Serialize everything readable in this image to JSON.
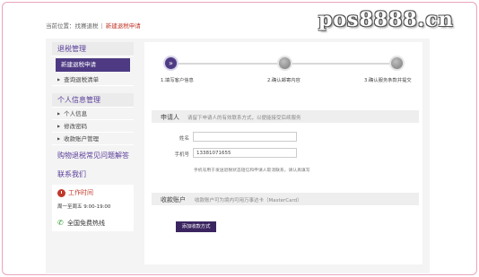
{
  "watermark": "pos8888.cn",
  "breadcrumb": {
    "prefix": "当前位置：",
    "items": [
      "找赛退税",
      "新建退税申请"
    ]
  },
  "sidebar": {
    "refund_head": "退税管理",
    "refund_items": [
      "新建退税申请",
      "查询退税清单"
    ],
    "personal_head": "个人信息管理",
    "personal_items": [
      "个人信息",
      "修改密码",
      "收款账户管理"
    ],
    "faq_link": "购物退税常见问题解答",
    "contact_head": "联系我们",
    "work_time_label": "工作时间",
    "work_hours": "周一至周五 9:00-19:00",
    "hotline_label": "全国免费热线"
  },
  "progress": {
    "steps": [
      "1.填写客户信息",
      "2.确认邮寄内容",
      "3.确认服务条款并提交"
    ],
    "active_glyph": "»"
  },
  "applicant": {
    "title": "申请人",
    "hint": "请留下申请人的有效联系方式，以便能接受后续服务",
    "name_label": "姓名",
    "name_value": "",
    "phone_label": "手机号",
    "phone_value": "13381071655",
    "note": "手机号用于发送退税状态短信和申请人取消联系，请认真填写"
  },
  "account": {
    "title": "收款账户",
    "hint": "收款账户可为境内可用万事达卡（MasterCard）",
    "add_button": "添加收款方式"
  },
  "colors": {
    "brand": "#4d3a83",
    "alert": "#c0392b",
    "frame": "#e9a4bd"
  }
}
